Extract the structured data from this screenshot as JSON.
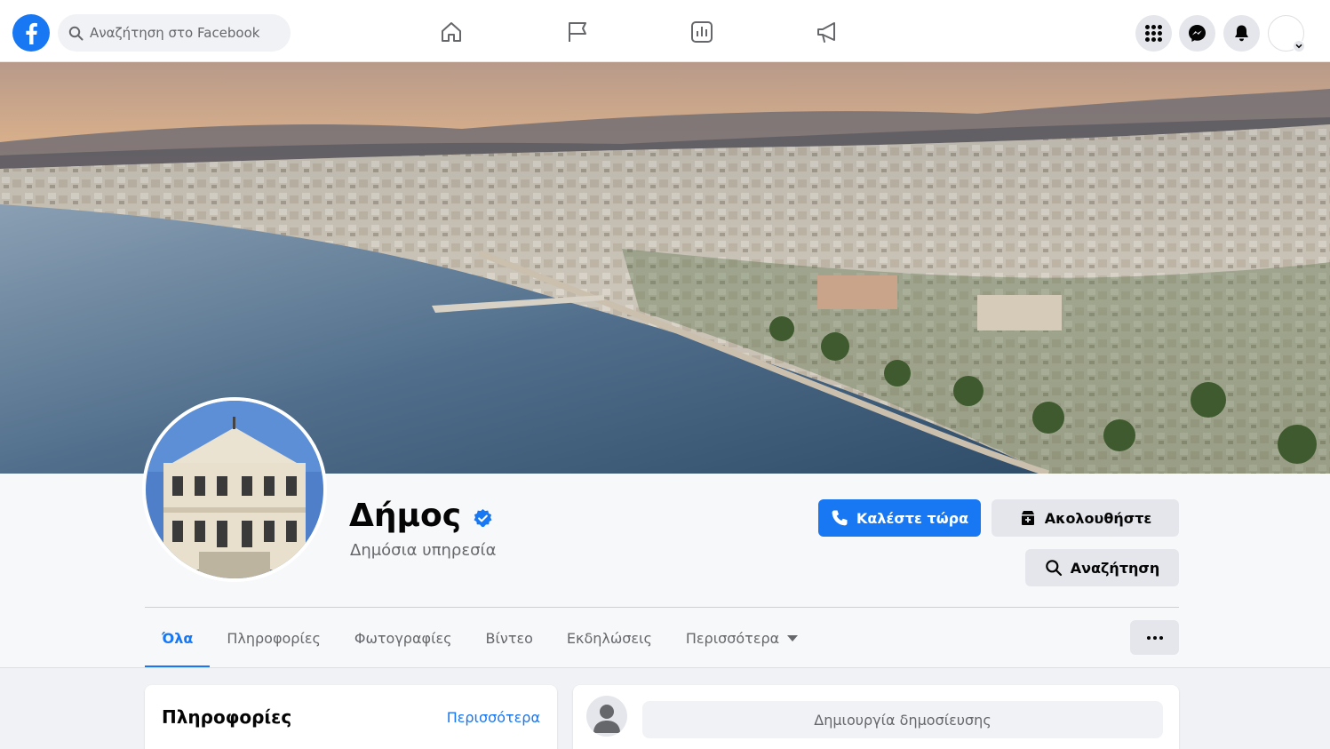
{
  "topbar": {
    "search_placeholder": "Αναζήτηση στο Facebook",
    "nav_icons": [
      "home-icon",
      "flag-icon",
      "insights-icon",
      "megaphone-icon"
    ],
    "right_icons": [
      "menu-grid-icon",
      "messenger-icon",
      "bell-icon"
    ]
  },
  "page": {
    "name": "Δήμος",
    "category": "Δημόσια υπηρεσία",
    "verified": true
  },
  "actions": {
    "call_label": "Καλέστε τώρα",
    "follow_label": "Ακολουθήστε",
    "search_label": "Αναζήτηση"
  },
  "tabs": [
    {
      "label": "Όλα",
      "active": true
    },
    {
      "label": "Πληροφορίες",
      "active": false
    },
    {
      "label": "Φωτογραφίες",
      "active": false
    },
    {
      "label": "Βίντεο",
      "active": false
    },
    {
      "label": "Εκδηλώσεις",
      "active": false
    },
    {
      "label": "Περισσότερα",
      "active": false
    }
  ],
  "info_card": {
    "title": "Πληροφορίες",
    "more_link": "Περισσότερα"
  },
  "post_card": {
    "prompt": "Δημιουργία δημοσίευσης"
  },
  "colors": {
    "accent": "#1877f2",
    "button_gray": "#e4e6eb",
    "background": "#f0f2f5"
  }
}
